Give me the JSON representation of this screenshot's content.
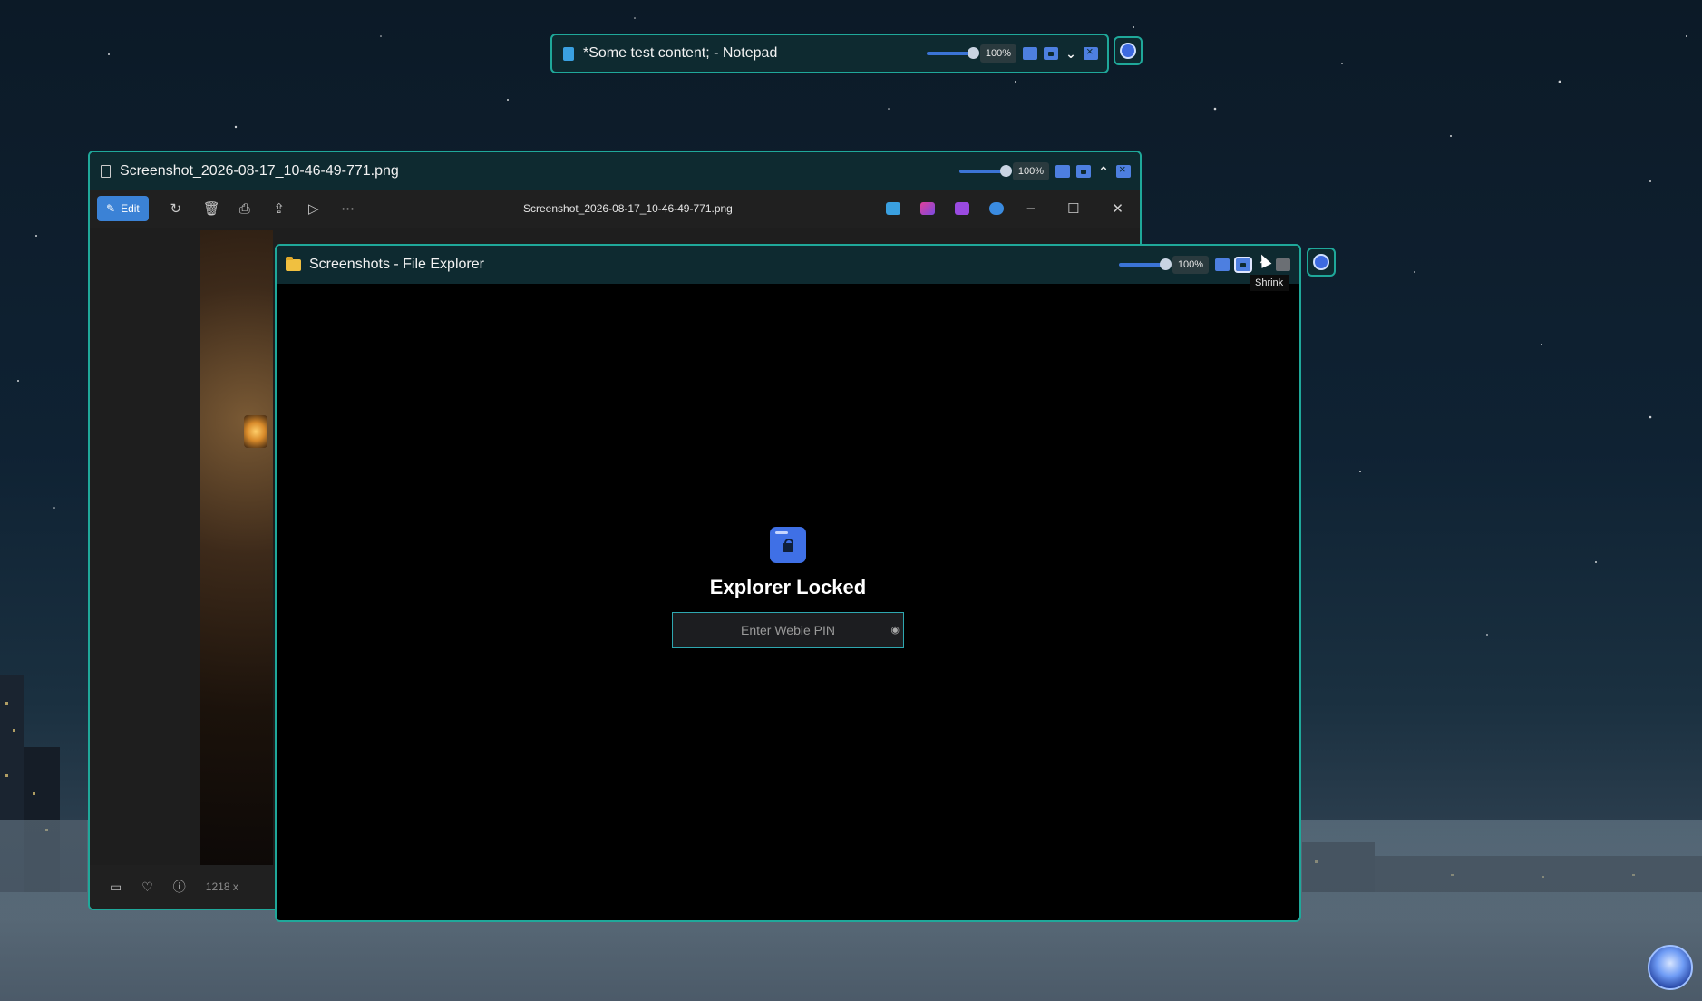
{
  "notepad_bar": {
    "title": "*Some test content; - Notepad",
    "zoom": "100%",
    "zoom_fraction": 1.0
  },
  "photos_window": {
    "title": "Screenshot_2026-08-17_10-46-49-771.png",
    "zoom": "100%",
    "toolbar": {
      "edit_label": "Edit",
      "file_name": "Screenshot_2026-08-17_10-46-49-771.png"
    },
    "bottom": {
      "dimensions_partial": "1218 x"
    }
  },
  "explorer_window": {
    "title": "Screenshots - File Explorer",
    "zoom": "100%",
    "lock": {
      "title": "Explorer Locked",
      "pin_placeholder": "Enter Webie PIN"
    }
  },
  "tooltip": {
    "text": "Shrink"
  },
  "icons": {
    "notepad": "notepad-icon",
    "folder": "folder-icon",
    "lock": "lock-icon",
    "assistant": "assistant-avatar-icon"
  },
  "colors": {
    "accent_border": "#1fa89a",
    "bar_background": "#0e2a30",
    "button_blue": "#4d7fe0",
    "edit_button": "#3b82d6"
  }
}
